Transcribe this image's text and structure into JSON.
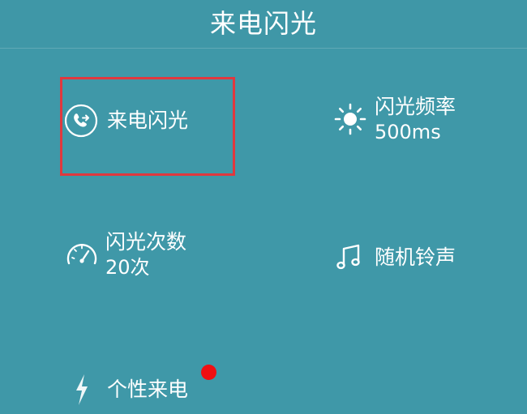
{
  "header": {
    "title": "来电闪光"
  },
  "items": {
    "flash": {
      "title": "来电闪光",
      "icon": "phone-incoming-circle-icon",
      "selected": true
    },
    "frequency": {
      "title": "闪光频率",
      "value": "500ms",
      "icon": "sun-icon"
    },
    "count": {
      "title": "闪光次数",
      "value": "20次",
      "icon": "speedometer-icon"
    },
    "ringtone": {
      "title": "随机铃声",
      "icon": "music-note-icon"
    },
    "personal": {
      "title": "个性来电",
      "icon": "lightning-icon",
      "badge": "new"
    }
  },
  "colors": {
    "background": "#3f98a8",
    "highlight": "#e0383e",
    "badge": "#f00f12",
    "text": "#ffffff"
  }
}
